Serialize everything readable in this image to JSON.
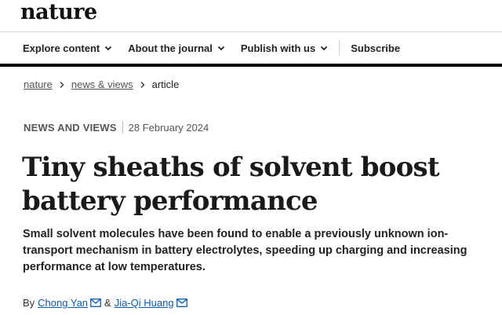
{
  "brand": {
    "logo_text": "nature"
  },
  "nav": {
    "items": [
      {
        "label": "Explore content",
        "icon": "chevron-down-icon"
      },
      {
        "label": "About the journal",
        "icon": "chevron-down-icon"
      },
      {
        "label": "Publish with us",
        "icon": "chevron-down-icon"
      }
    ],
    "subscribe_label": "Subscribe"
  },
  "breadcrumb": [
    {
      "label": "nature"
    },
    {
      "label": "news & views"
    },
    {
      "label": "article"
    }
  ],
  "article": {
    "type": "NEWS AND VIEWS",
    "date": "28 February 2024",
    "title": "Tiny sheaths of solvent boost battery performance",
    "standfirst": "Small solvent molecules have been found to enable a previously unknown ion-transport mechanism in battery electrolytes, speeding up charging and increasing performance at low temperatures.",
    "byline_prefix": "By",
    "authors": [
      {
        "name": "Chong Yan",
        "icon": "mail-icon"
      },
      {
        "name": "Jia-Qi Huang",
        "icon": "mail-icon"
      }
    ],
    "author_joiner": "&"
  },
  "colors": {
    "link": "#0a5ab0",
    "nav_rule": "#000000",
    "text": "#222222"
  }
}
